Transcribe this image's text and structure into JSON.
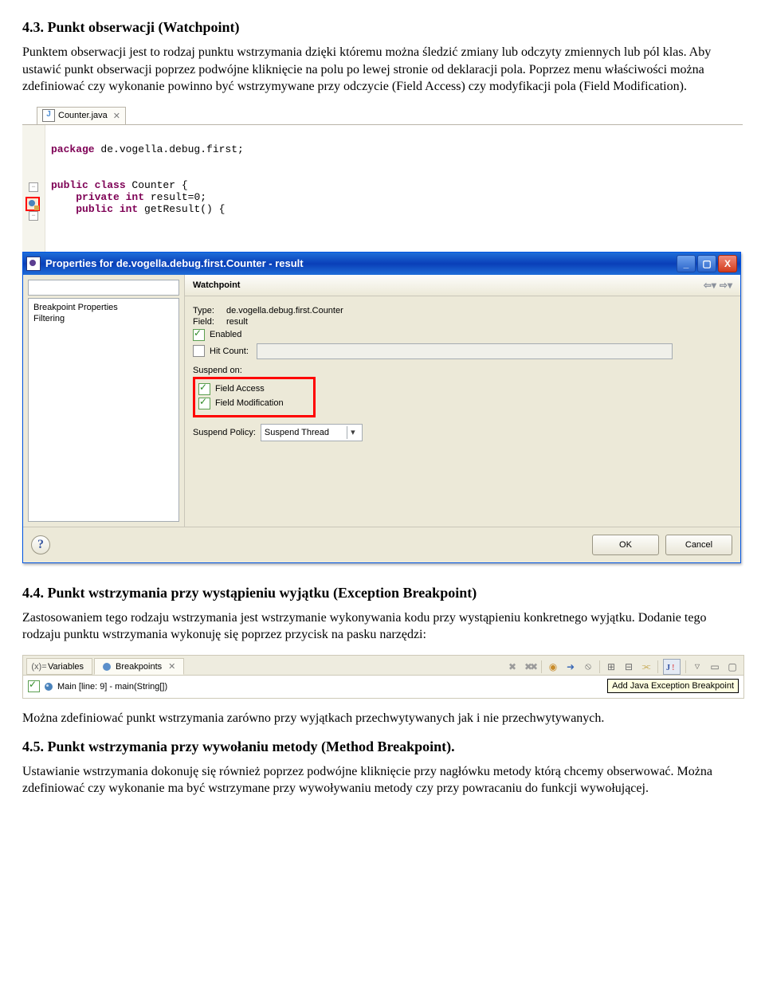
{
  "sec43": {
    "heading": "4.3.  Punkt obserwacji (Watchpoint)",
    "p1": "Punktem obserwacji jest to rodzaj punktu wstrzymania dzięki któremu można śledzić zmiany lub odczyty zmiennych lub pól klas. Aby ustawić punkt obserwacji poprzez podwójne kliknięcie na polu po lewej stronie od deklaracji pola. Poprzez menu właściwości można zdefiniować czy wykonanie powinno być wstrzymywane przy odczycie (Field Access) czy modyfikacji pola (Field Modification)."
  },
  "shot1": {
    "editor_tab": "Counter.java",
    "code_l1_a": "package",
    "code_l1_b": " de.vogella.debug.first;",
    "code_l2_a": "public class",
    "code_l2_b": " Counter {",
    "code_l3_a": "private int",
    "code_l3_b": " result=0;",
    "code_l4_a": "public int",
    "code_l4_b": " getResult() {",
    "dialog": {
      "title": "Properties for de.vogella.debug.first.Counter - result",
      "tree_item1": "Breakpoint Properties",
      "tree_item2": "Filtering",
      "rp_heading": "Watchpoint",
      "type_label": "Type:",
      "type_value": "de.vogella.debug.first.Counter",
      "field_label": "Field:",
      "field_value": "result",
      "enabled": "Enabled",
      "hitcount": "Hit Count:",
      "suspend_on": "Suspend on:",
      "field_access": "Field Access",
      "field_modification": "Field Modification",
      "suspend_policy_label": "Suspend Policy:",
      "suspend_policy_value": "Suspend Thread",
      "ok": "OK",
      "cancel": "Cancel"
    }
  },
  "sec44": {
    "heading": "4.4. Punkt wstrzymania przy wystąpieniu wyjątku (Exception Breakpoint)",
    "p1": "Zastosowaniem tego rodzaju wstrzymania jest wstrzymanie wykonywania kodu przy wystąpieniu konkretnego wyjątku. Dodanie tego rodzaju punktu wstrzymania wykonuję się poprzez przycisk na pasku narzędzi:"
  },
  "shot2": {
    "tab_variables": "Variables",
    "tab_breakpoints": "Breakpoints",
    "bp_entry": "Main [line: 9] - main(String[])",
    "tooltip": "Add Java Exception Breakpoint"
  },
  "para_after2": "Można zdefiniować punkt wstrzymania zarówno przy wyjątkach przechwytywanych jak i nie przechwytywanych.",
  "sec45": {
    "heading": "4.5.  Punkt wstrzymania przy wywołaniu metody (Method Breakpoint).",
    "p1": "Ustawianie wstrzymania dokonuję się również poprzez podwójne kliknięcie przy nagłówku metody którą chcemy obserwować. Można zdefiniować czy wykonanie ma być wstrzymane przy wywoływaniu metody czy przy powracaniu do funkcji wywołującej."
  }
}
